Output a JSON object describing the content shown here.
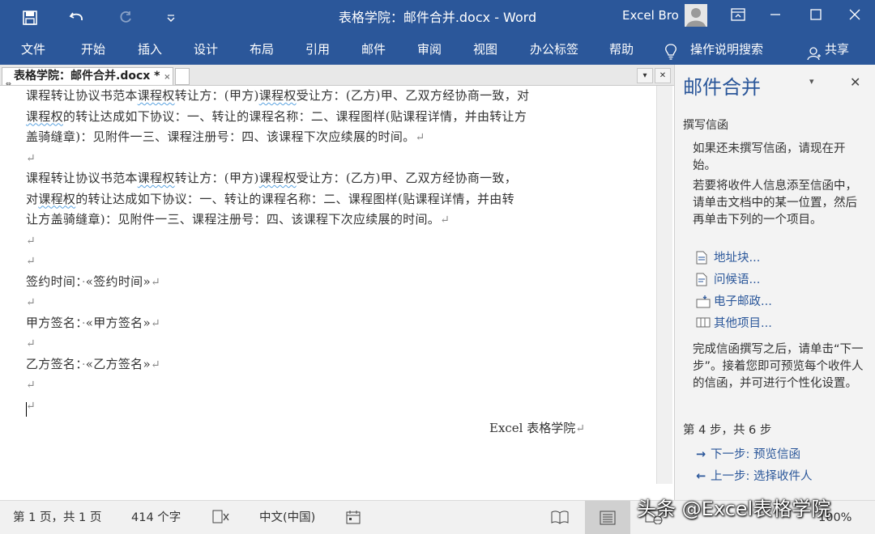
{
  "titlebar": {
    "doc_title": "表格学院：邮件合并.docx  -  Word",
    "user_name": "Excel Bro",
    "quick_access": [
      "save-icon",
      "undo-icon",
      "redo-icon",
      "customize-icon"
    ]
  },
  "menu": {
    "items": [
      "文件",
      "开始",
      "插入",
      "设计",
      "布局",
      "引用",
      "邮件",
      "审阅",
      "视图",
      "办公标签",
      "帮助"
    ],
    "tell_me": "操作说明搜索",
    "share": "共享"
  },
  "doctab": {
    "label": "表格学院：邮件合并.docx *",
    "close": "×"
  },
  "document": {
    "para1": [
      "课程转让协议书范本课程权转让方：(甲方)课程权受让方：(乙方)甲、乙双方经协商一致，对",
      "课程权的转让达成如下协议：一、转让的课程名称：二、课程图样(贴课程详情，并由转让方",
      "盖骑缝章)：见附件一三、课程注册号：四、该课程下次应续展的时间。"
    ],
    "para2": [
      "课程转让协议书范本课程权转让方：(甲方)课程权受让方：(乙方)甲、乙双方经协商一致，",
      "对课程权的转让达成如下协议：一、转让的课程名称：二、课程图样(贴课程详情，并由转",
      "让方盖骑缝章)：见附件一三、课程注册号：四、该课程下次应续展的时间。"
    ],
    "sign_time_label": "签约时间：",
    "sign_time_field": "«签约时间»",
    "party_a_label": "甲方签名：",
    "party_a_field": "«甲方签名»",
    "party_b_label": "乙方签名：",
    "party_b_field": "«乙方签名»",
    "signature": "Excel 表格学院",
    "para_mark": "↵"
  },
  "pane": {
    "title": "邮件合并",
    "section": "撰写信函",
    "intro1": "如果还未撰写信函，请现在开始。",
    "intro2": "若要将收件人信息添至信函中，请单击文档中的某一位置，然后再单击下列的一个项目。",
    "links": [
      "地址块...",
      "问候语...",
      "电子邮政...",
      "其他项目..."
    ],
    "after": "完成信函撰写之后，请单击“下一步”。接着您即可预览每个收件人的信函，并可进行个性化设置。",
    "step": "第 4 步，共 6 步",
    "next": "下一步: 预览信函",
    "prev": "上一步: 选择收件人"
  },
  "status": {
    "page": "第 1 页，共 1 页",
    "words": "414 个字",
    "language": "中文(中国)",
    "zoom": "100%"
  },
  "watermark": "头条 @Excel表格学院",
  "colors": {
    "accent": "#2b579a",
    "status_bg": "#f1f1f1",
    "pane_bg": "#f3f3f3"
  }
}
